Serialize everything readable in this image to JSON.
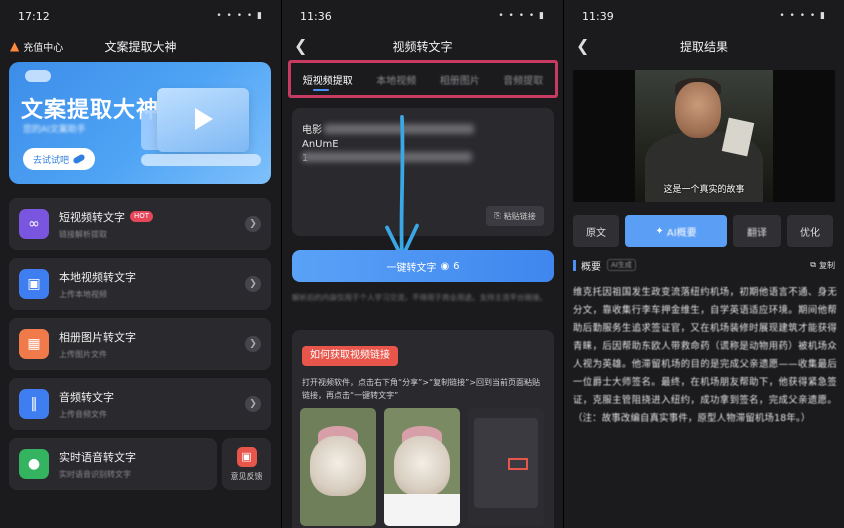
{
  "screen1": {
    "time": "17:12",
    "status_icons": "• • • • ▮",
    "recharge_label": "充值中心",
    "app_title": "文案提取大神",
    "banner": {
      "title": "文案提取大神",
      "subtitle": "您的AI文案助手",
      "button": "去试试吧"
    },
    "menu": [
      {
        "name": "短视频转文字",
        "desc": "链接解析提取",
        "badge": "HOT",
        "icon": "link-icon",
        "color": "#7a55e0"
      },
      {
        "name": "本地视频转文字",
        "desc": "上传本地视频",
        "icon": "video-camera-icon",
        "color": "#3f7ef0"
      },
      {
        "name": "相册图片转文字",
        "desc": "上传图片文件",
        "icon": "image-icon",
        "color": "#f07a4a"
      },
      {
        "name": "音频转文字",
        "desc": "上传音频文件",
        "icon": "audio-wave-icon",
        "color": "#3f7ef0"
      },
      {
        "name": "实时语音转文字",
        "desc": "实时语音识别转文字",
        "icon": "microphone-icon",
        "color": "#34b361"
      }
    ],
    "feedback_label": "意见反馈"
  },
  "screen2": {
    "time": "11:36",
    "status_icons": "• • • • ▮",
    "title": "视频转文字",
    "tabs": [
      "短视频提取",
      "本地视频",
      "相册图片",
      "音频提取"
    ],
    "input_prefix": "电影",
    "input_line2": "AnUmE",
    "input_line3": "1",
    "paste_label": "粘贴链接",
    "convert_label": "一键转文字",
    "convert_count": "6",
    "note": "解析后的内容仅用于个人学习交流，不得用于商业用途。支持主流平台链接。",
    "guide_title": "如何获取视频链接",
    "guide_text": "打开视频软件，点击右下角“分享”>“复制链接”>回到当前页面粘贴链接，再点击“一键转文字”"
  },
  "screen3": {
    "time": "11:39",
    "status_icons": "• • • • ▮",
    "title": "提取结果",
    "subtitle_caption": "这是一个真实的故事",
    "result_tabs": [
      "原文",
      "AI概要",
      "翻译",
      "优化"
    ],
    "summary_label": "概要",
    "summary_tag": "AI生成",
    "copy_label": "复制",
    "summary_text": "维克托因祖国发生政变流落纽约机场，初期他语言不通、身无分文，靠收集行李车押金维生，自学英语适应环境。期间他帮助后勤服务生追求签证官，又在机场装修时展现建筑才能获得青睐，后因帮助东欧人带救命药（谎称是动物用药）被机场众人视为英雄。他滞留机场的目的是完成父亲遗愿——收集最后一位爵士大师签名。最终，在机场朋友帮助下，他获得紧急签证，克服主管阻挠进入纽约，成功拿到签名，完成父亲遗愿。（注：故事改编自真实事件，原型人物滞留机场18年。）"
  },
  "colors": {
    "accent_blue": "#4b8ff5",
    "highlight_red": "#c73a62",
    "card_bg": "#2a2a2e",
    "page_bg": "#1b1b1e"
  }
}
